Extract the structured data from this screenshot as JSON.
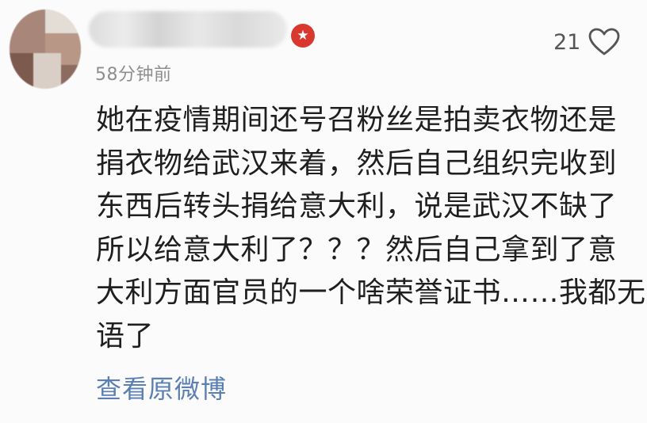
{
  "comment": {
    "timestamp": "58分钟前",
    "like_count": "21",
    "body_lines": [
      "她在疫情期间还号召粉丝是拍卖衣物还是",
      "捐衣物给武汉来着，然后自己组织完收到",
      "东西后转头捐给意大利，说是武汉不缺了",
      "所以给意大利了？？？然后自己拿到了意",
      "大利方面官员的一个啥荣誉证书……我都无",
      "语了"
    ],
    "view_original_label": "查看原微博"
  },
  "icons": {
    "like": "heart-icon",
    "badge": "verified-badge-icon"
  },
  "colors": {
    "link": "#5a7fb5",
    "badge": "#d8382e",
    "text": "#1f1f1f",
    "muted": "#8e8e8e"
  }
}
